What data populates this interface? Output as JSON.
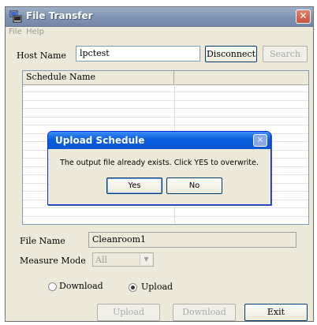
{
  "window": {
    "title": "File Transfer",
    "close_glyph": "✕"
  },
  "menu": {
    "items": [
      "File",
      "Help"
    ]
  },
  "connection": {
    "host_label": "Host Name",
    "host_value": "lpctest",
    "disconnect_label": "Disconnect",
    "search_label": "Search"
  },
  "schedule_list": {
    "columns": [
      "Schedule Name",
      ""
    ]
  },
  "file": {
    "file_name_label": "File Name",
    "file_name_value": "Cleanroom1",
    "measure_mode_label": "Measure Mode",
    "measure_mode_value": "All"
  },
  "transfer_mode": {
    "download_label": "Download",
    "upload_label": "Upload",
    "selected": "Upload"
  },
  "actions": {
    "upload_label": "Upload",
    "download_label": "Download",
    "exit_label": "Exit"
  },
  "dialog": {
    "title": "Upload Schedule",
    "message": "The output file already exists.  Click YES to overwrite.",
    "yes_label": "Yes",
    "no_label": "No",
    "close_glyph": "✕"
  },
  "icons": {
    "app": "computer-transfer-icon",
    "window_close": "close-icon",
    "dialog_close": "close-icon",
    "dropdown": "chevron-down-icon"
  },
  "colors": {
    "window_bg": "#ece9d8",
    "title_bar": "#7f95b3",
    "dialog_title_bar": "#0a5fe0",
    "close_button": "#c8533c"
  }
}
